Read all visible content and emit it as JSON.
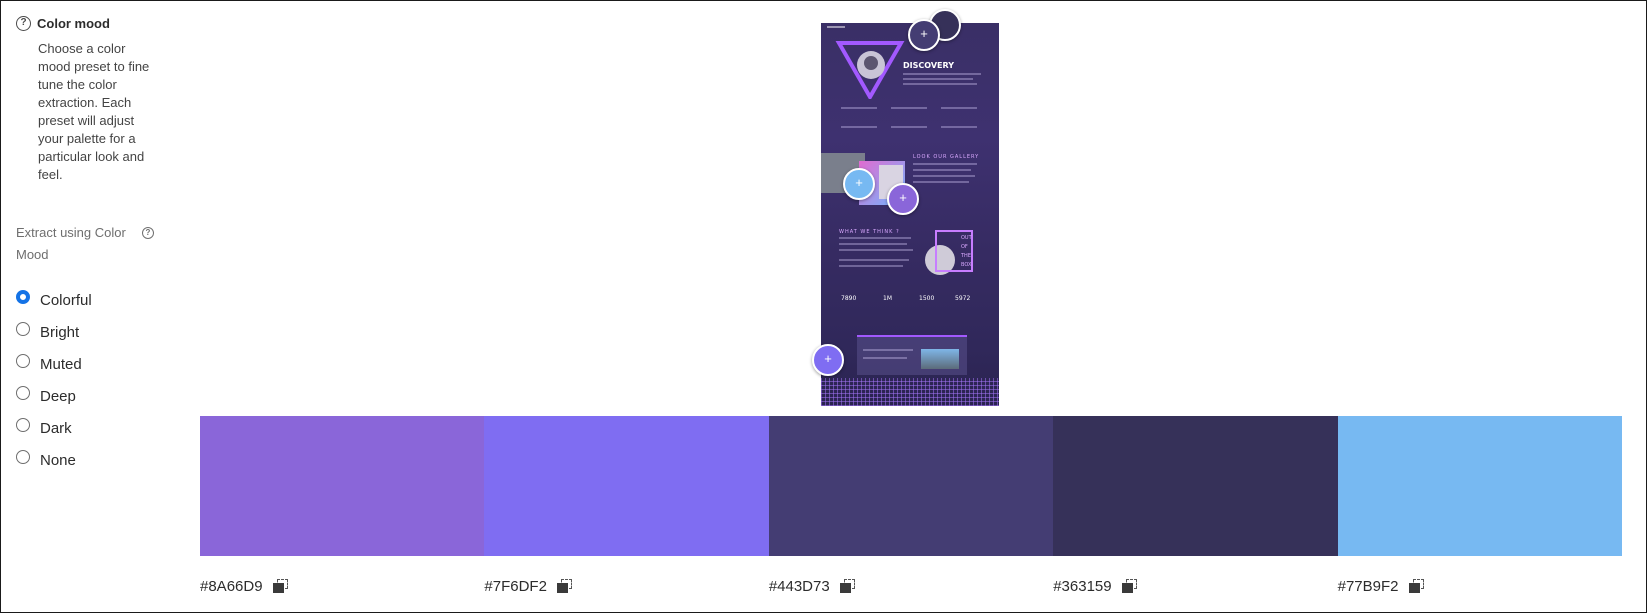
{
  "color_mood": {
    "title": "Color mood",
    "description": "Choose a color mood preset to fine tune the color extraction. Each preset will adjust your palette for a particular look and feel.",
    "help_icon": "question-circle-icon"
  },
  "extract": {
    "label": "Extract using Color Mood",
    "help_icon": "question-circle-icon"
  },
  "moods": [
    {
      "label": "Colorful",
      "checked": true
    },
    {
      "label": "Bright",
      "checked": false
    },
    {
      "label": "Muted",
      "checked": false
    },
    {
      "label": "Deep",
      "checked": false
    },
    {
      "label": "Dark",
      "checked": false
    },
    {
      "label": "None",
      "checked": false
    }
  ],
  "preview": {
    "heading": "DISCOVERY",
    "gallery_heading": "LOOK OUR GALLERY",
    "what_heading": "WHAT WE THINK ?",
    "out_box": [
      "OUT",
      "OF",
      "THE",
      "BOX"
    ],
    "stats": [
      "7890",
      "1M",
      "1500",
      "5972"
    ],
    "picker_symbol": "+"
  },
  "palette": [
    {
      "hex": "#8A66D9",
      "copy_icon": "copy-icon"
    },
    {
      "hex": "#7F6DF2",
      "copy_icon": "copy-icon"
    },
    {
      "hex": "#443D73",
      "copy_icon": "copy-icon"
    },
    {
      "hex": "#363159",
      "copy_icon": "copy-icon"
    },
    {
      "hex": "#77B9F2",
      "copy_icon": "copy-icon"
    }
  ]
}
